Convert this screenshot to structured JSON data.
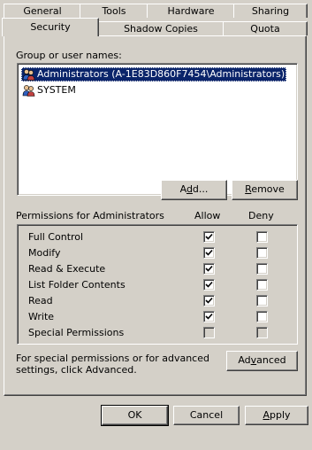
{
  "tabs_row1": [
    {
      "label": "General"
    },
    {
      "label": "Tools"
    },
    {
      "label": "Hardware"
    },
    {
      "label": "Sharing"
    }
  ],
  "tabs_row2": [
    {
      "label": "Security",
      "active": true
    },
    {
      "label": "Shadow Copies"
    },
    {
      "label": "Quota"
    }
  ],
  "group_label": "Group or user names:",
  "users": [
    {
      "name": "Administrators (A-1E83D860F7454\\Administrators)",
      "selected": true,
      "icon": "user-group-icon"
    },
    {
      "name": "SYSTEM",
      "selected": false,
      "icon": "user-group-icon"
    }
  ],
  "buttons": {
    "add": {
      "pre": "A",
      "acc": "d",
      "post": "d..."
    },
    "remove": {
      "pre": "",
      "acc": "R",
      "post": "emove"
    },
    "advanced": {
      "pre": "Ad",
      "acc": "v",
      "post": "anced"
    },
    "ok": "OK",
    "cancel": "Cancel",
    "apply": {
      "pre": "",
      "acc": "A",
      "post": "pply"
    }
  },
  "permissions_title": "Permissions for Administrators",
  "col_allow": "Allow",
  "col_deny": "Deny",
  "permissions": [
    {
      "name": "Full Control",
      "allow": true,
      "deny": false
    },
    {
      "name": "Modify",
      "allow": true,
      "deny": false
    },
    {
      "name": "Read & Execute",
      "allow": true,
      "deny": false
    },
    {
      "name": "List Folder Contents",
      "allow": true,
      "deny": false
    },
    {
      "name": "Read",
      "allow": true,
      "deny": false
    },
    {
      "name": "Write",
      "allow": true,
      "deny": false
    },
    {
      "name": "Special Permissions",
      "allow": false,
      "deny": false,
      "disabled": true
    }
  ],
  "advanced_note": "For special permissions or for advanced settings, click Advanced."
}
